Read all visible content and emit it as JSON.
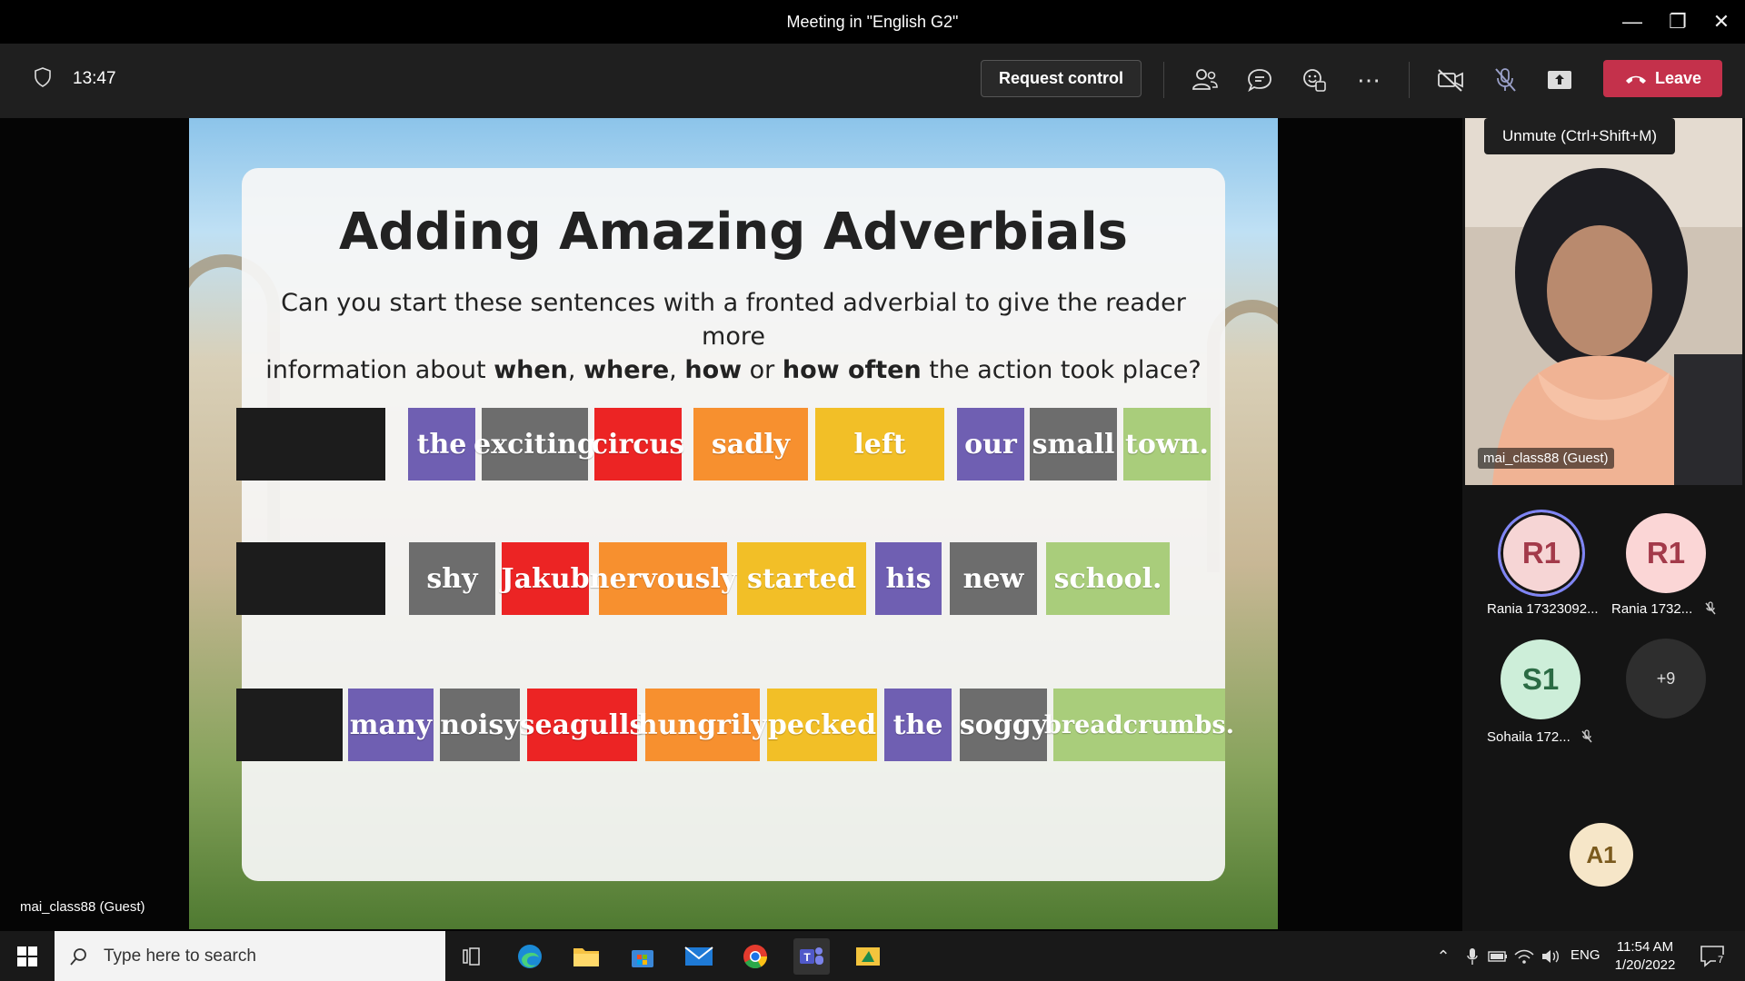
{
  "titlebar": {
    "title": "Meeting in \"English G2\""
  },
  "toolbar": {
    "timer": "13:47",
    "request_control": "Request control",
    "leave": "Leave"
  },
  "tooltip": "Unmute (Ctrl+Shift+M)",
  "slide": {
    "title": "Adding Amazing Adverbials",
    "subtitle_line1": "Can you start these sentences with a fronted adverbial to give the reader more",
    "subtitle_pre": "information about ",
    "b1": "when",
    "c1": ", ",
    "b2": "where",
    "c2": ", ",
    "b3": "how",
    "c3": " or ",
    "b4": "how often",
    "c4": " the action took place?",
    "rows": [
      [
        {
          "text": "the",
          "color": "#6f5fb2"
        },
        {
          "text": "exciting",
          "color": "#6d6d6d"
        },
        {
          "text": "circus",
          "color": "#ec2424"
        },
        {
          "text": "sadly",
          "color": "#f7902f"
        },
        {
          "text": "left",
          "color": "#f2bf27"
        },
        {
          "text": "our",
          "color": "#6f5fb2"
        },
        {
          "text": "small",
          "color": "#6d6d6d"
        },
        {
          "text": "town.",
          "color": "#a9cd7b"
        }
      ],
      [
        {
          "text": "shy",
          "color": "#6d6d6d"
        },
        {
          "text": "Jakub",
          "color": "#ec2424"
        },
        {
          "text": "nervously",
          "color": "#f7902f"
        },
        {
          "text": "started",
          "color": "#f2bf27"
        },
        {
          "text": "his",
          "color": "#6f5fb2"
        },
        {
          "text": "new",
          "color": "#6d6d6d"
        },
        {
          "text": "school.",
          "color": "#a9cd7b"
        }
      ],
      [
        {
          "text": "many",
          "color": "#6f5fb2"
        },
        {
          "text": "noisy",
          "color": "#6d6d6d"
        },
        {
          "text": "seagulls",
          "color": "#ec2424"
        },
        {
          "text": "hungrily",
          "color": "#f7902f"
        },
        {
          "text": "pecked",
          "color": "#f2bf27"
        },
        {
          "text": "the",
          "color": "#6f5fb2"
        },
        {
          "text": "soggy",
          "color": "#6d6d6d"
        },
        {
          "text": "breadcrumbs.",
          "color": "#a9cd7b"
        }
      ]
    ]
  },
  "presenter_label": "mai_class88 (Guest)",
  "self_video_name": "mai_class88 (Guest)",
  "participants": [
    {
      "initials": "R1",
      "name": "Rania 17323092...",
      "bg": "#f6d5d5",
      "fg": "#a33a4a",
      "muted": false
    },
    {
      "initials": "R1",
      "name": "Rania 1732...",
      "bg": "#fbd6d6",
      "fg": "#a33a4a",
      "muted": true
    },
    {
      "initials": "S1",
      "name": "Sohaila 172...",
      "bg": "#cdeed9",
      "fg": "#2b6b44",
      "muted": true
    }
  ],
  "overflow_count": "+9",
  "extra_avatar": {
    "initials": "A1",
    "bg": "#f6e6c8",
    "fg": "#7a5a1d"
  },
  "taskbar": {
    "search_placeholder": "Type here to search",
    "lang": "ENG",
    "time": "11:54 AM",
    "date": "1/20/2022",
    "notifications": "7"
  }
}
